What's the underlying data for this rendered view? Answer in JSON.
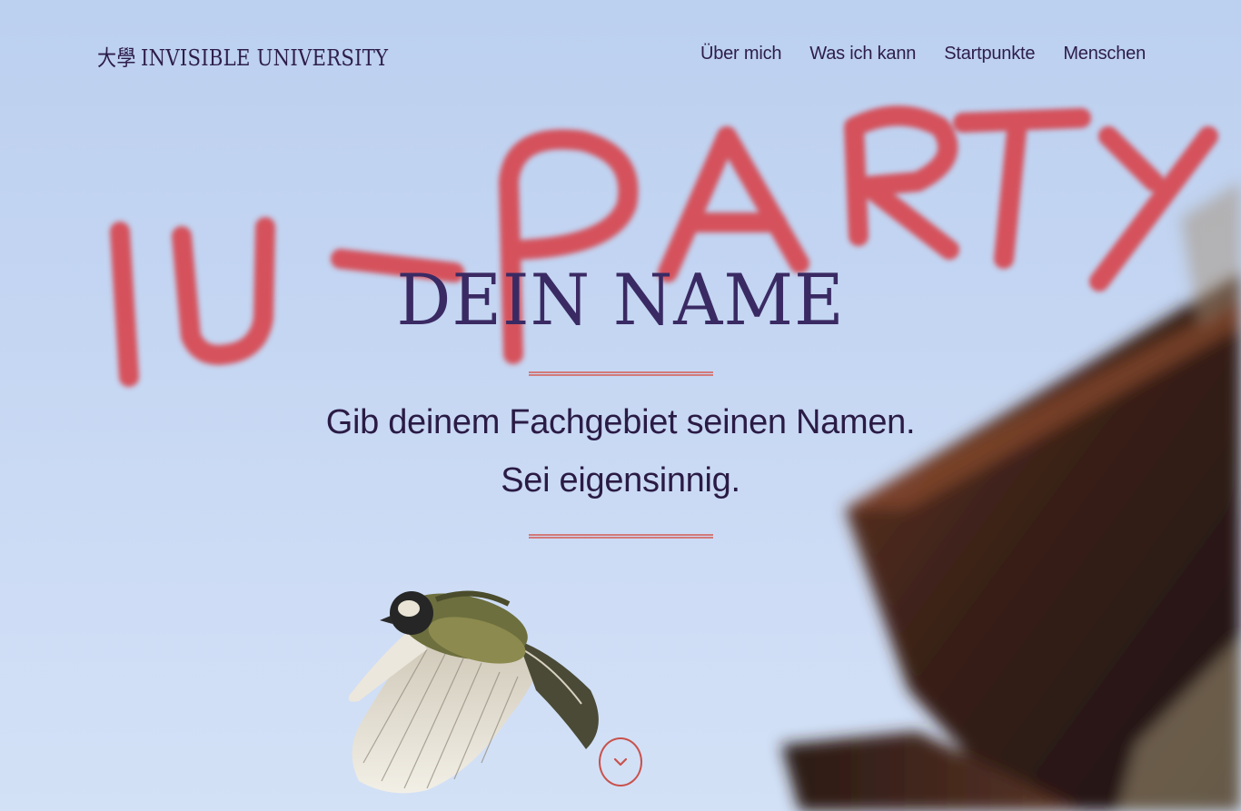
{
  "header": {
    "brand_logo": "大學",
    "brand_name": "INVISIBLE UNIVERSITY",
    "nav": [
      "Über mich",
      "Was ich kann",
      "Startpunkte",
      "Menschen"
    ]
  },
  "hero": {
    "overlay_text": "IU - PARTY",
    "title": "DEIN NAME",
    "tagline_line1": "Gib deinem Fachgebiet seinen Namen.",
    "tagline_line2": "Sei eigensinnig.",
    "scroll_icon": "chevron-down-icon"
  },
  "colors": {
    "text": "#2d1d4b",
    "accent": "#c8524c",
    "sky": "#c3d5f2",
    "overlay_red": "#d9343a"
  }
}
